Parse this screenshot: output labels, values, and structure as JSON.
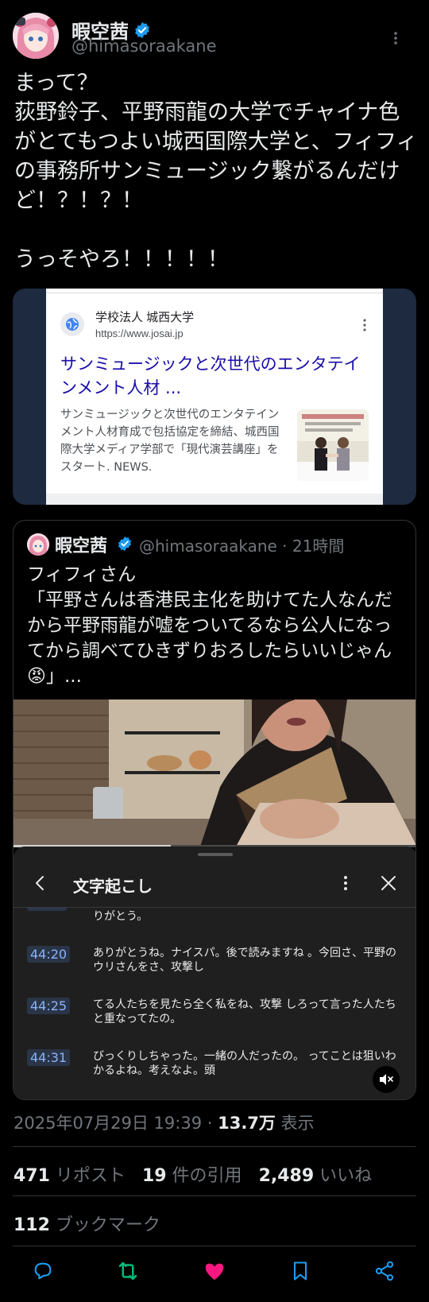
{
  "author": {
    "display_name": "暇空茜",
    "handle": "@himasoraakane"
  },
  "tweet": {
    "text": "まって？\n荻野鈴子、平野雨龍の大学でチャイナ色がとてもつよい城西国際大学と、フィフィの事務所サンミュージック繋がるんだけど！？！？！\n\nうっそやろ！！！！！"
  },
  "link_card": {
    "site_name": "学校法人 城西大学",
    "url": "https://www.josai.jp",
    "title": "サンミュージックと次世代のエンタテインメント人材 ...",
    "description": "サンミュージックと次世代のエンタテインメント人材育成で包括協定を締結、城西国際大学メディア学部で「現代演芸講座」をスタート. NEWS."
  },
  "quote": {
    "display_name": "暇空茜",
    "meta": "@himasoraakane · 21時間",
    "text": "フィフィさん\n「平野さんは香港民主化を助けてた人なんだから平野雨龍が嘘をついてるなら公人になってから調べてひきずりおろしたらいいじゃん😡」...",
    "video_progress": 0.39
  },
  "transcript": {
    "title": "文字起こし",
    "partial_text": "りがとう。",
    "items": [
      {
        "time": "44:20",
        "text": "ありがとうね。ナイスパ。後で読みますね 。今回さ、平野のウリさんをさ、攻撃し"
      },
      {
        "time": "44:25",
        "text": "てる人たちを見たら全く私をね、攻撃 しろって言った人たちと重なってたの。"
      },
      {
        "time": "44:31",
        "text": "びっくりしちゃった。一緒の人だったの。 ってことは狙いわかるよね。考えなよ。頭"
      }
    ]
  },
  "meta": {
    "datetime": "2025年07月29日 19:39 · ",
    "views_value": "13.7万",
    "views_label": " 表示"
  },
  "stats": {
    "reposts_value": "471",
    "reposts_label": " リポスト",
    "quotes_value": "19",
    "quotes_label": " 件の引用",
    "likes_value": "2,489",
    "likes_label": " いいね",
    "bookmarks_value": "112",
    "bookmarks_label": " ブックマーク"
  },
  "colors": {
    "accent": "#1d9bf0",
    "repost_active": "#00ba7c",
    "like_active": "#f91880",
    "icon_gray": "#71767b"
  },
  "icons": [
    "more-icon",
    "verified-icon",
    "globe-icon",
    "back-icon",
    "close-icon",
    "mute-icon",
    "reply-icon",
    "repost-icon",
    "like-icon",
    "bookmark-icon",
    "share-icon"
  ]
}
